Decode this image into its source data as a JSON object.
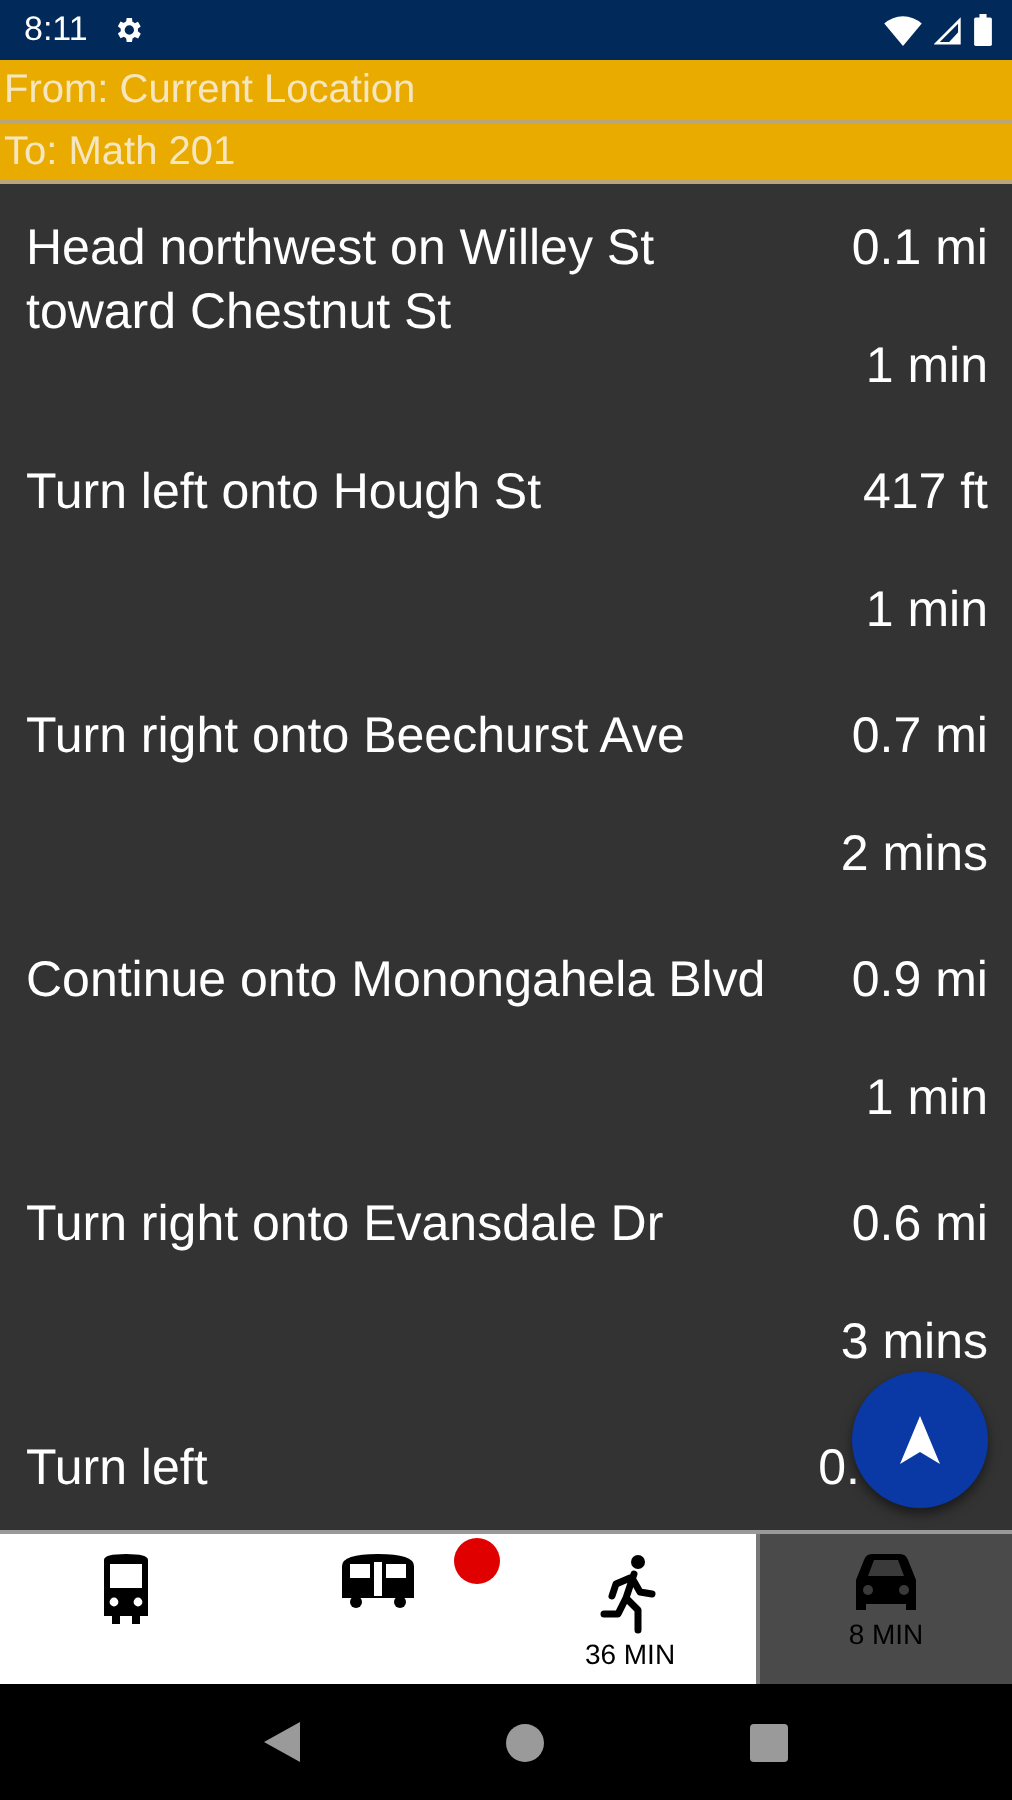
{
  "status_bar": {
    "time": "8:11"
  },
  "route": {
    "from": "From: Current Location",
    "to": "To: Math 201"
  },
  "steps": [
    {
      "instruction": "Head northwest on Willey St toward Chestnut St",
      "distance": "0.1 mi",
      "time": "1 min"
    },
    {
      "instruction": "Turn left onto Hough St",
      "distance": "417 ft",
      "time": "1 min"
    },
    {
      "instruction": "Turn right onto Beechurst Ave",
      "distance": "0.7 mi",
      "time": "2 mins"
    },
    {
      "instruction": "Continue onto Monongahela Blvd",
      "distance": "0.9 mi",
      "time": "1 min"
    },
    {
      "instruction": "Turn right onto Evansdale Dr",
      "distance": "0.6 mi",
      "time": "3 mins"
    },
    {
      "instruction": "Turn left",
      "distance": "0."
    }
  ],
  "modes": [
    {
      "kind": "bus",
      "selected": false,
      "badge": false
    },
    {
      "kind": "train",
      "selected": false,
      "badge": true
    },
    {
      "kind": "walk",
      "selected": false,
      "badge": false,
      "label": "36 MIN"
    },
    {
      "kind": "car",
      "selected": true,
      "badge": false,
      "label": "8 MIN"
    }
  ]
}
